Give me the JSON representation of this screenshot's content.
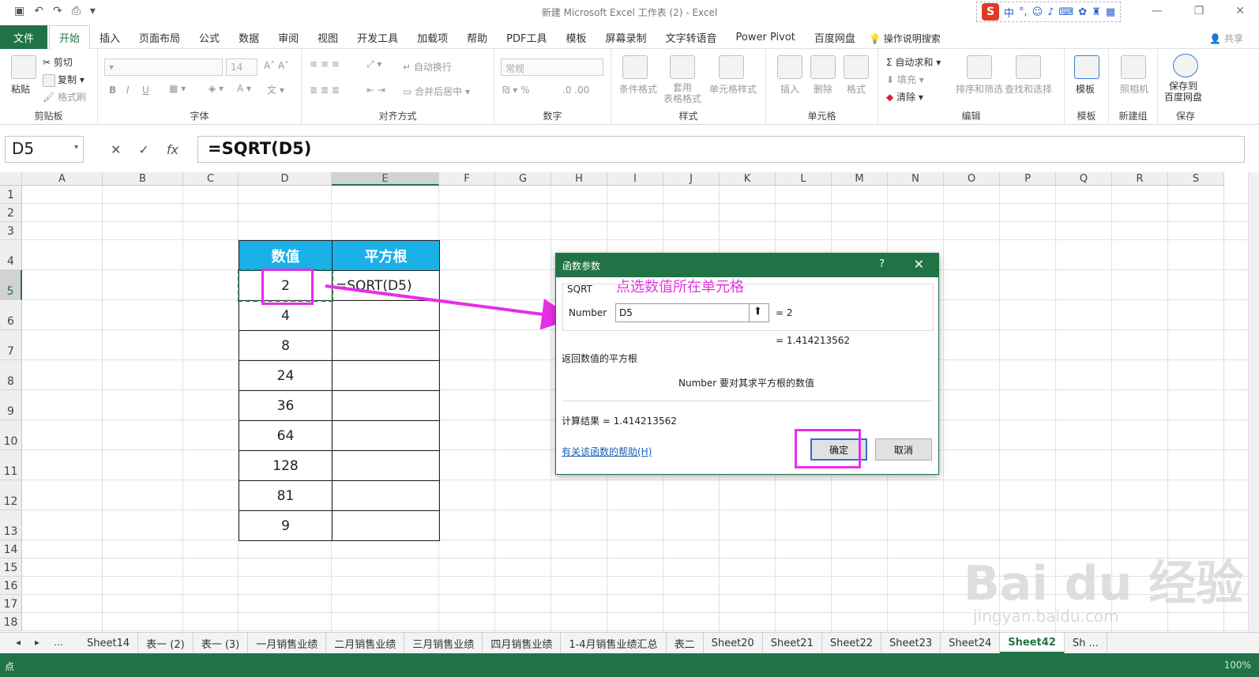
{
  "window": {
    "title": "新建 Microsoft Excel 工作表 (2)  -  Excel",
    "ime_label": "中",
    "ime_logo": "S"
  },
  "menu": {
    "file": "文件",
    "tabs": [
      "开始",
      "插入",
      "页面布局",
      "公式",
      "数据",
      "审阅",
      "视图",
      "开发工具",
      "加载项",
      "帮助",
      "PDF工具",
      "模板",
      "屏幕录制",
      "文字转语音",
      "Power Pivot",
      "百度网盘"
    ],
    "tell_me": "操作说明搜索",
    "share": "共享"
  },
  "ribbon": {
    "clipboard": {
      "name": "剪贴板",
      "paste": "粘贴",
      "cut": "剪切",
      "copy": "复制",
      "format_painter": "格式刷"
    },
    "font": {
      "name": "字体",
      "font_size": "14",
      "bold": "B",
      "italic": "I",
      "underline": "U"
    },
    "alignment": {
      "name": "对齐方式",
      "wrap": "自动换行",
      "merge": "合并后居中"
    },
    "number": {
      "name": "数字",
      "format": "常规"
    },
    "styles": {
      "name": "样式",
      "conditional": "条件格式",
      "table": "套用\n表格格式",
      "cell": "单元格样式"
    },
    "cells": {
      "name": "单元格",
      "insert": "插入",
      "delete": "删除",
      "format": "格式"
    },
    "editing": {
      "name": "编辑",
      "autosum": "自动求和",
      "fill": "填充",
      "clear": "清除",
      "sort": "排序和筛选",
      "find": "查找和选择"
    },
    "template": {
      "name": "模板",
      "label": "模板"
    },
    "newgroup": {
      "name": "新建组",
      "label": "照相机"
    },
    "save": {
      "name": "保存",
      "label": "保存到\n百度网盘"
    }
  },
  "formula_bar": {
    "name_box": "D5",
    "cancel": "✕",
    "enter": "✓",
    "fx": "fx",
    "formula": "=SQRT(D5)"
  },
  "sheet": {
    "columns": [
      "A",
      "B",
      "C",
      "D",
      "E",
      "F",
      "G",
      "H",
      "I",
      "J",
      "K",
      "L",
      "M",
      "N",
      "O",
      "P",
      "Q",
      "R",
      "S"
    ],
    "rows": [
      "1",
      "2",
      "3",
      "4",
      "5",
      "6",
      "7",
      "8",
      "9",
      "10",
      "11",
      "12",
      "13",
      "14",
      "15",
      "16",
      "17",
      "18"
    ],
    "table_headers": [
      "数值",
      "平方根"
    ],
    "values": [
      "2",
      "4",
      "8",
      "24",
      "36",
      "64",
      "128",
      "81",
      "9"
    ],
    "e5_formula": "=SQRT(D5)"
  },
  "dialog": {
    "title": "函数参数",
    "help_btn": "?",
    "close_btn": "✕",
    "function_name": "SQRT",
    "arg_label": "Number",
    "arg_value": "D5",
    "arg_result": "=  2",
    "total_result": "=  1.414213562",
    "description": "返回数值的平方根",
    "arg_description": "Number   要对其求平方根的数值",
    "calc_result_label": "计算结果 =   1.414213562",
    "help_link": "有关该函数的帮助(H)",
    "ok": "确定",
    "cancel": "取消",
    "annotation": "点选数值所在单元格"
  },
  "sheet_tabs": {
    "more": "...",
    "tabs": [
      "Sheet14",
      "表一 (2)",
      "表一 (3)",
      "一月销售业绩",
      "二月销售业绩",
      "三月销售业绩",
      "四月销售业绩",
      "1-4月销售业绩汇总",
      "表二",
      "Sheet20",
      "Sheet21",
      "Sheet22",
      "Sheet23",
      "Sheet24",
      "Sheet42",
      "Sh ..."
    ],
    "active": "Sheet42"
  },
  "status": {
    "ready": "点",
    "zoom": "100%"
  },
  "watermark": {
    "main": "Bai du 经验",
    "sub": "jingyan.baidu.com"
  },
  "colors": {
    "excel_green": "#217346",
    "header_blue": "#1ab0e8",
    "annotation_magenta": "#e62ee6"
  }
}
